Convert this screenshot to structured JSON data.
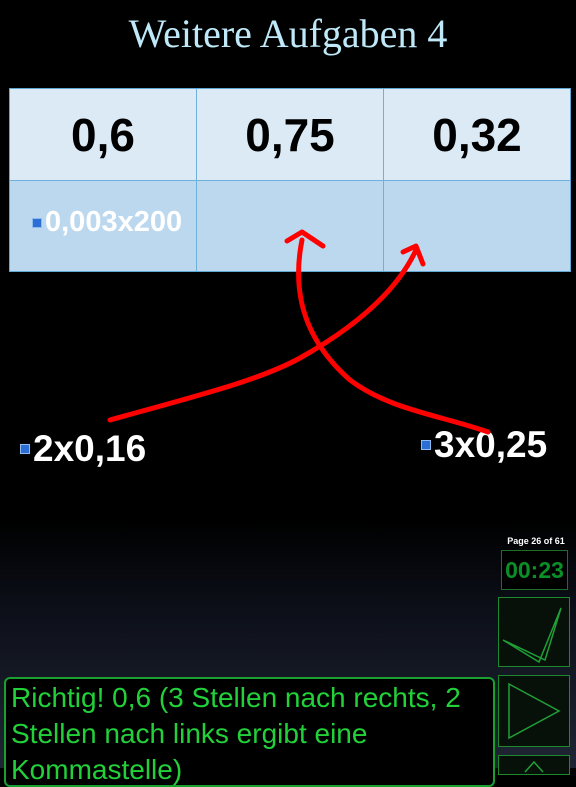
{
  "page": {
    "title": "Weitere Aufgaben 4"
  },
  "table": {
    "headers": [
      "0,6",
      "0,75",
      "0,32"
    ],
    "placed_term": "0,003x200"
  },
  "terms": [
    {
      "label": "2x0,16"
    },
    {
      "label": "3x0,25"
    }
  ],
  "controls": {
    "page_indicator": "Page 26 of 61",
    "timer": "00:23"
  },
  "feedback": {
    "text": "Richtig! 0,6 (3 Stellen nach rechts, 2 Stellen nach links ergibt eine Kommastelle)"
  },
  "colors": {
    "background": "#000000",
    "title": "#bfe8f8",
    "table_header": "#dceaf6",
    "table_body": "#bcd8ee",
    "annotation": "#ff0000",
    "feedback_text": "#22d13a",
    "timer": "#0a8f26"
  },
  "icons": {
    "check_button": "checkmark-icon",
    "play_button": "play-icon",
    "up_button": "arrow-up-icon",
    "term_marker": "square-marker-icon"
  }
}
